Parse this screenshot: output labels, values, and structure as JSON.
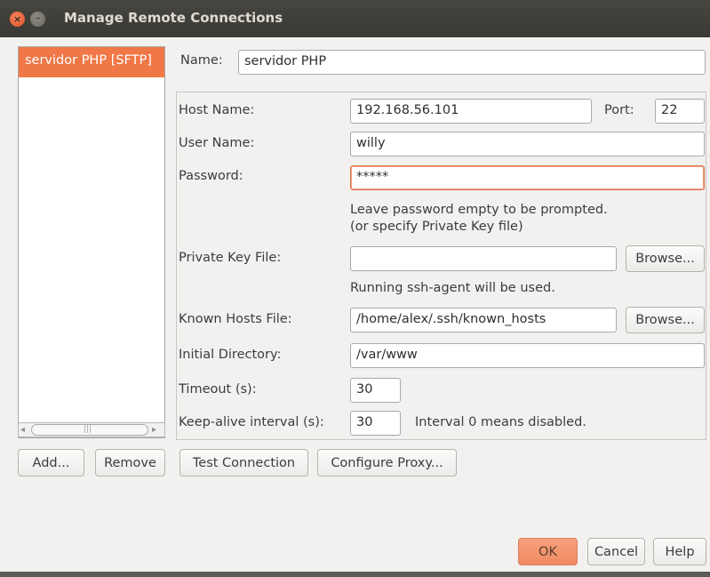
{
  "window": {
    "title": "Manage Remote Connections",
    "close_glyph": "×",
    "minimize_glyph": "–",
    "close_icon": "close-icon",
    "minimize_icon": "minimize-icon"
  },
  "connections": {
    "items": [
      {
        "label": "servidor PHP [SFTP]",
        "selected": true
      }
    ],
    "scroll_left_glyph": "◂",
    "scroll_right_glyph": "▸",
    "scroll_grip_glyph": "|||"
  },
  "list_buttons": {
    "add": "Add...",
    "remove": "Remove"
  },
  "form": {
    "name_label": "Name:",
    "name_value": "servidor PHP",
    "host_label": "Host Name:",
    "host_value": "192.168.56.101",
    "port_label": "Port:",
    "port_value": "22",
    "user_label": "User Name:",
    "user_value": "willy",
    "password_label": "Password:",
    "password_value": "*****",
    "password_hint_1": "Leave password empty to be prompted.",
    "password_hint_2": "(or specify Private Key file)",
    "private_key_label": "Private Key File:",
    "private_key_value": "",
    "ssh_agent_hint": "Running ssh-agent will be used.",
    "known_hosts_label": "Known Hosts File:",
    "known_hosts_value": "/home/alex/.ssh/known_hosts",
    "initial_dir_label": "Initial Directory:",
    "initial_dir_value": "/var/www",
    "timeout_label": "Timeout (s):",
    "timeout_value": "30",
    "keepalive_label": "Keep-alive interval (s):",
    "keepalive_value": "30",
    "keepalive_hint": "Interval 0 means disabled.",
    "browse_label": "Browse..."
  },
  "actions": {
    "test_connection": "Test Connection",
    "configure_proxy": "Configure Proxy..."
  },
  "dialog_buttons": {
    "ok": "OK",
    "cancel": "Cancel",
    "help": "Help"
  },
  "colors": {
    "accent": "#f07746",
    "titlebar": "#3c3b37",
    "background": "#f2f1f0",
    "focus_border": "#e2704a"
  }
}
